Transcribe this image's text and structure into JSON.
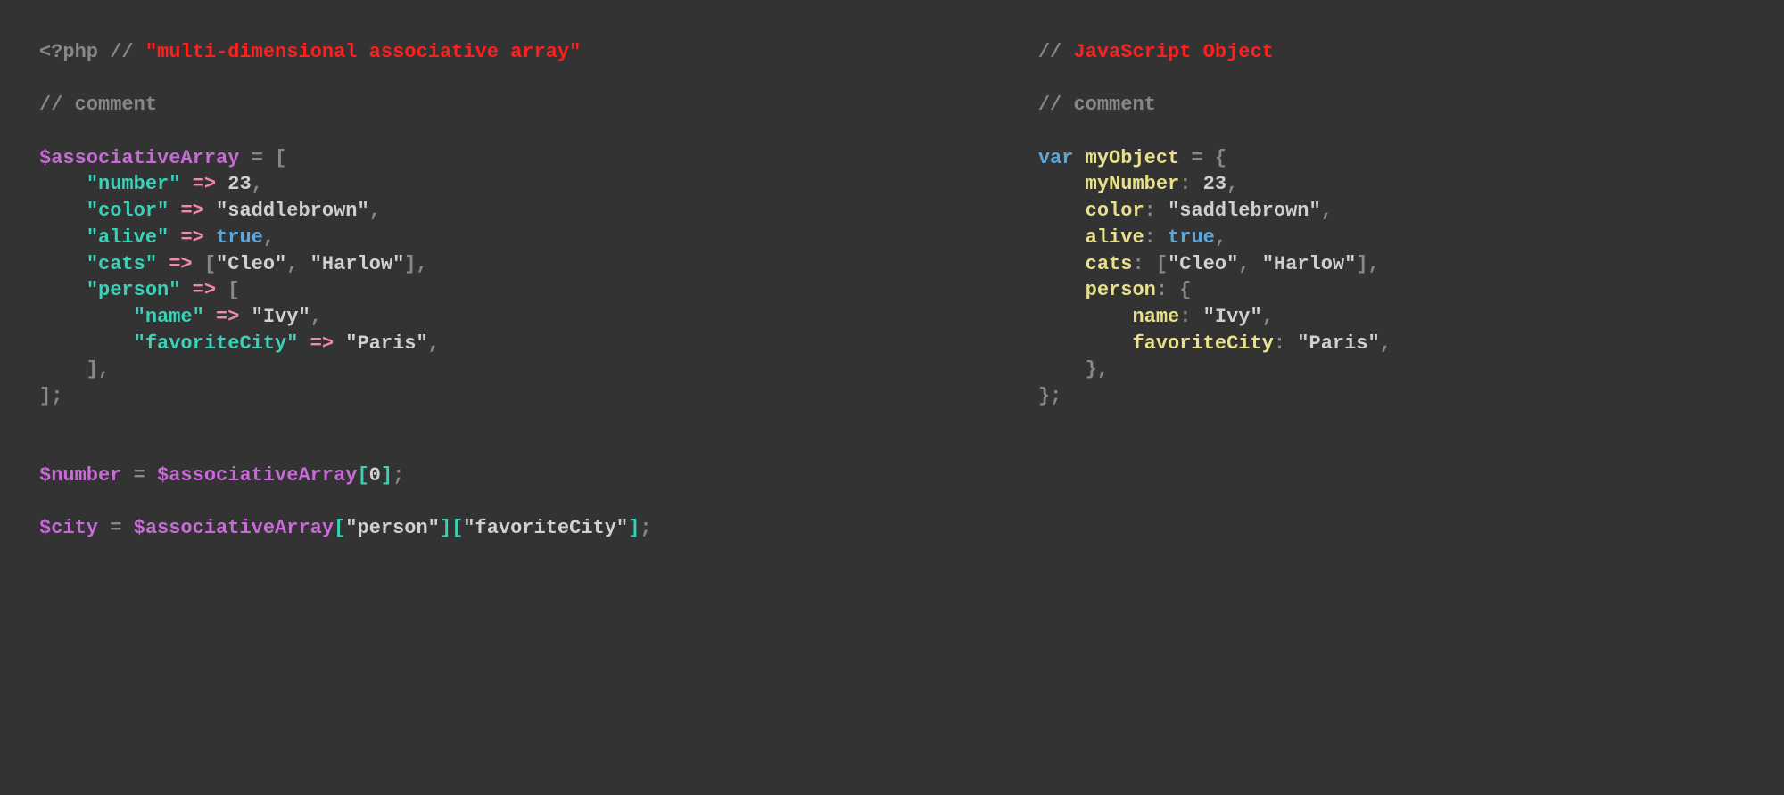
{
  "left": {
    "phpTag": "<?php",
    "commentSlash": "//",
    "title": "\"multi-dimensional associative array\"",
    "commentText": "comment",
    "var1": "$associativeArray",
    "eq": "=",
    "open": "[",
    "arrow": "=>",
    "key_number": "\"number\"",
    "val_number": "23",
    "key_color": "\"color\"",
    "val_color": "\"saddlebrown\"",
    "key_alive": "\"alive\"",
    "val_alive": "true",
    "key_cats": "\"cats\"",
    "val_cats_open": "[",
    "val_cats_0": "\"Cleo\"",
    "val_cats_1": "\"Harlow\"",
    "val_cats_close": "]",
    "key_person": "\"person\"",
    "person_open": "[",
    "key_name": "\"name\"",
    "val_name": "\"Ivy\"",
    "key_favCity": "\"favoriteCity\"",
    "val_favCity": "\"Paris\"",
    "person_close": "]",
    "close": "];",
    "var2": "$number",
    "access1a": "$associativeArray",
    "access1b": "0",
    "var3": "$city",
    "access2a": "$associativeArray",
    "access2b": "\"person\"",
    "access2c": "\"favoriteCity\""
  },
  "right": {
    "commentSlash": "//",
    "title": "JavaScript Object",
    "commentText": "comment",
    "kw_var": "var",
    "var1": "myObject",
    "eq": "=",
    "open": "{",
    "key_number": "myNumber",
    "val_number": "23",
    "key_color": "color",
    "val_color": "\"saddlebrown\"",
    "key_alive": "alive",
    "val_alive": "true",
    "key_cats": "cats",
    "val_cats_open": "[",
    "val_cats_0": "\"Cleo\"",
    "val_cats_1": "\"Harlow\"",
    "val_cats_close": "]",
    "key_person": "person",
    "person_open": "{",
    "key_name": "name",
    "val_name": "\"Ivy\"",
    "key_favCity": "favoriteCity",
    "val_favCity": "\"Paris\"",
    "person_close": "}",
    "close": "};"
  },
  "punct": {
    "comma": ",",
    "colon": ":",
    "semi": ";",
    "lbrack": "[",
    "rbrack": "]"
  }
}
